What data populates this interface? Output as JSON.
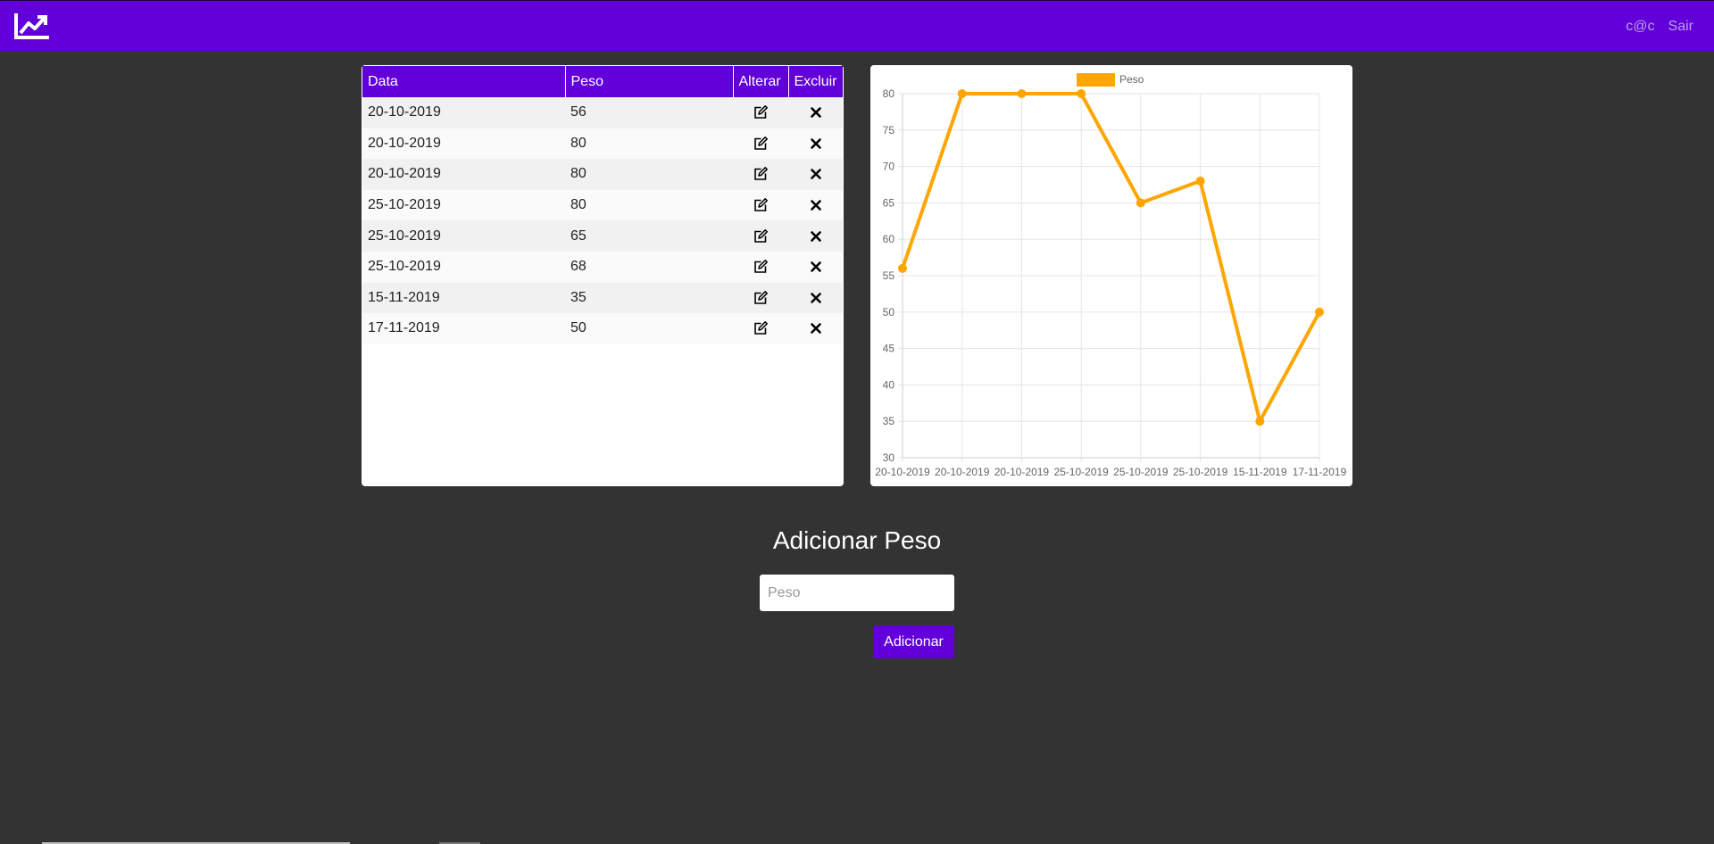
{
  "navbar": {
    "brand_icon": "chart-line-icon",
    "user": "c@c",
    "logout": "Sair"
  },
  "table": {
    "headers": [
      "Data",
      "Peso",
      "Alterar",
      "Excluir"
    ],
    "rows": [
      {
        "date": "20-10-2019",
        "weight": "56"
      },
      {
        "date": "20-10-2019",
        "weight": "80"
      },
      {
        "date": "20-10-2019",
        "weight": "80"
      },
      {
        "date": "25-10-2019",
        "weight": "80"
      },
      {
        "date": "25-10-2019",
        "weight": "65"
      },
      {
        "date": "25-10-2019",
        "weight": "68"
      },
      {
        "date": "15-11-2019",
        "weight": "35"
      },
      {
        "date": "17-11-2019",
        "weight": "50"
      }
    ],
    "edit_icon": "edit-icon",
    "delete_icon": "close-icon"
  },
  "chart_data": {
    "type": "line",
    "categories": [
      "20-10-2019",
      "20-10-2019",
      "20-10-2019",
      "25-10-2019",
      "25-10-2019",
      "25-10-2019",
      "15-11-2019",
      "17-11-2019"
    ],
    "series": [
      {
        "name": "Peso",
        "values": [
          56,
          80,
          80,
          80,
          65,
          68,
          35,
          50
        ],
        "color": "#ffa500"
      }
    ],
    "ylim": [
      30,
      80
    ],
    "yticks": [
      30,
      35,
      40,
      45,
      50,
      55,
      60,
      65,
      70,
      75,
      80
    ],
    "grid": true,
    "legend": "top-center"
  },
  "form": {
    "title": "Adicionar Peso",
    "input_placeholder": "Peso",
    "input_value": "",
    "submit_label": "Adicionar"
  },
  "colors": {
    "primary": "#6200d9",
    "background": "#333333",
    "chart_line": "#ffa500"
  }
}
